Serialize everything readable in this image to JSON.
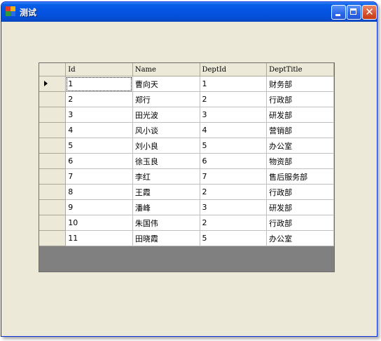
{
  "window": {
    "title": "测试",
    "icon": "winforms-app-icon",
    "controls": {
      "minimize_icon": "minimize-icon",
      "maximize_icon": "maximize-icon",
      "close_icon": "close-icon",
      "close_glyph": "✕"
    }
  },
  "grid": {
    "current_row": 0,
    "columns": [
      "Id",
      "Name",
      "DeptId",
      "DeptTitle"
    ],
    "rows": [
      [
        "1",
        "曹向天",
        "1",
        "财务部"
      ],
      [
        "2",
        "郑行",
        "2",
        "行政部"
      ],
      [
        "3",
        "田光波",
        "3",
        "研发部"
      ],
      [
        "4",
        "风小谈",
        "4",
        "营销部"
      ],
      [
        "5",
        "刘小良",
        "5",
        "办公室"
      ],
      [
        "6",
        "徐玉良",
        "6",
        "物资部"
      ],
      [
        "7",
        "李红",
        "7",
        "售后服务部"
      ],
      [
        "8",
        "王霞",
        "2",
        "行政部"
      ],
      [
        "9",
        "潘峰",
        "3",
        "研发部"
      ],
      [
        "10",
        "朱国伟",
        "2",
        "行政部"
      ],
      [
        "11",
        "田晓霞",
        "5",
        "办公室"
      ]
    ]
  },
  "colors": {
    "titlebar": "#0554e3",
    "window_bg": "#ece9d8",
    "grid_bg": "#808080"
  }
}
